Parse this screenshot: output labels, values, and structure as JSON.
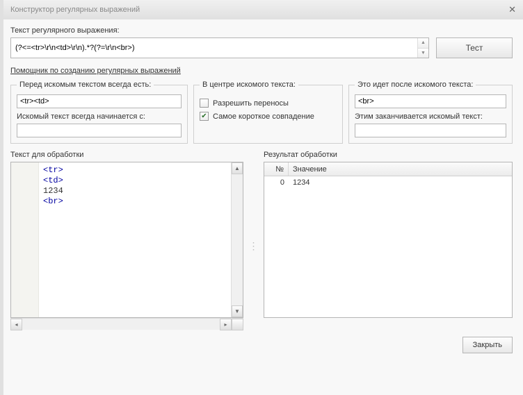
{
  "window": {
    "title": "Конструктор регулярных выражений"
  },
  "regex": {
    "label": "Текст регулярного выражения:",
    "value": "(?<=<tr>\\r\\n<td>\\r\\n).*?(?=\\r\\n<br>)",
    "test_button": "Тест"
  },
  "help_link": "Помощник по созданию регулярных выражений",
  "left_box": {
    "legend": "Перед искомым текстом всегда есть:",
    "value1": "<tr><td>",
    "label2": "Искомый текст всегда начинается с:",
    "value2": ""
  },
  "mid_box": {
    "legend": "В центре искомого текста:",
    "allow_wrap_label": "Разрешить переносы",
    "allow_wrap_checked": false,
    "shortest_label": "Самое короткое совпадение",
    "shortest_checked": true
  },
  "right_box": {
    "legend": "Это идет после искомого текста:",
    "value1": "<br>",
    "label2": "Этим заканчивается искомый текст:",
    "value2": ""
  },
  "source": {
    "label": "Текст для обработки",
    "lines": [
      {
        "text": "<tr>",
        "is_tag": true
      },
      {
        "text": "<td>",
        "is_tag": true
      },
      {
        "text": "1234",
        "is_tag": false
      },
      {
        "text": "<br>",
        "is_tag": true
      }
    ]
  },
  "result": {
    "label": "Результат обработки",
    "col_n": "№",
    "col_v": "Значение",
    "rows": [
      {
        "n": "0",
        "v": "1234"
      }
    ]
  },
  "footer": {
    "close": "Закрыть"
  }
}
